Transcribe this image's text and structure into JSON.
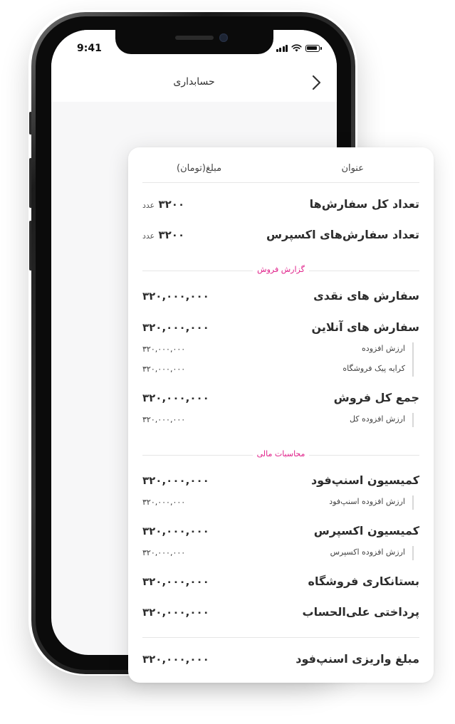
{
  "status_bar": {
    "time": "9:41"
  },
  "nav": {
    "title": "حسابداری"
  },
  "card": {
    "header": {
      "title_col": "عنوان",
      "amount_col": "مبلغ(تومان)"
    },
    "summary_rows": [
      {
        "label": "تعداد کل سفارش‌ها",
        "value": "۳۲۰۰",
        "unit": "عدد"
      },
      {
        "label": "تعداد سفارش‌های اکسپرس",
        "value": "۳۲۰۰",
        "unit": "عدد"
      }
    ],
    "sections": [
      {
        "title": "گزارش فروش",
        "groups": [
          {
            "label": "سفارش های نقدی",
            "value": "۳۲۰,۰۰۰,۰۰۰",
            "subs": []
          },
          {
            "label": "سفارش های آنلاین",
            "value": "۳۲۰,۰۰۰,۰۰۰",
            "subs": [
              {
                "label": "ارزش افزوده",
                "value": "۳۲۰,۰۰۰,۰۰۰"
              },
              {
                "label": "کرایه پیک فروشگاه",
                "value": "۳۲۰,۰۰۰,۰۰۰"
              }
            ]
          },
          {
            "label": "جمع کل فروش",
            "value": "۳۲۰,۰۰۰,۰۰۰",
            "subs": [
              {
                "label": "ارزش افزوده کل",
                "value": "۳۲۰,۰۰۰,۰۰۰"
              }
            ]
          }
        ]
      },
      {
        "title": "محاسبات مالی",
        "groups": [
          {
            "label": "کمیسیون اسنپ‌فود",
            "value": "۳۲۰,۰۰۰,۰۰۰",
            "subs": [
              {
                "label": "ارزش افزوده اسنپ‌فود",
                "value": "۳۲۰,۰۰۰,۰۰۰"
              }
            ]
          },
          {
            "label": "کمیسیون اکسپرس",
            "value": "۳۲۰,۰۰۰,۰۰۰",
            "subs": [
              {
                "label": "ارزش افزوده اکسپرس",
                "value": "۳۲۰,۰۰۰,۰۰۰"
              }
            ]
          },
          {
            "label": "بستانکاری فروشگاه",
            "value": "۳۲۰,۰۰۰,۰۰۰",
            "subs": []
          },
          {
            "label": "پرداختی علی‌الحساب",
            "value": "۳۲۰,۰۰۰,۰۰۰",
            "subs": []
          }
        ]
      }
    ],
    "total": {
      "label": "مبلغ واریزی اسنپ‌فود",
      "value": "۳۲۰,۰۰۰,۰۰۰"
    }
  },
  "colors": {
    "section_accent": "#e0218a",
    "screen_background": "#f7f7f8",
    "text": "#2d2d2d"
  },
  "icons": {
    "back": "chevron-right-icon",
    "signal": "cellular-signal-icon",
    "wifi": "wifi-icon",
    "battery": "battery-icon"
  }
}
